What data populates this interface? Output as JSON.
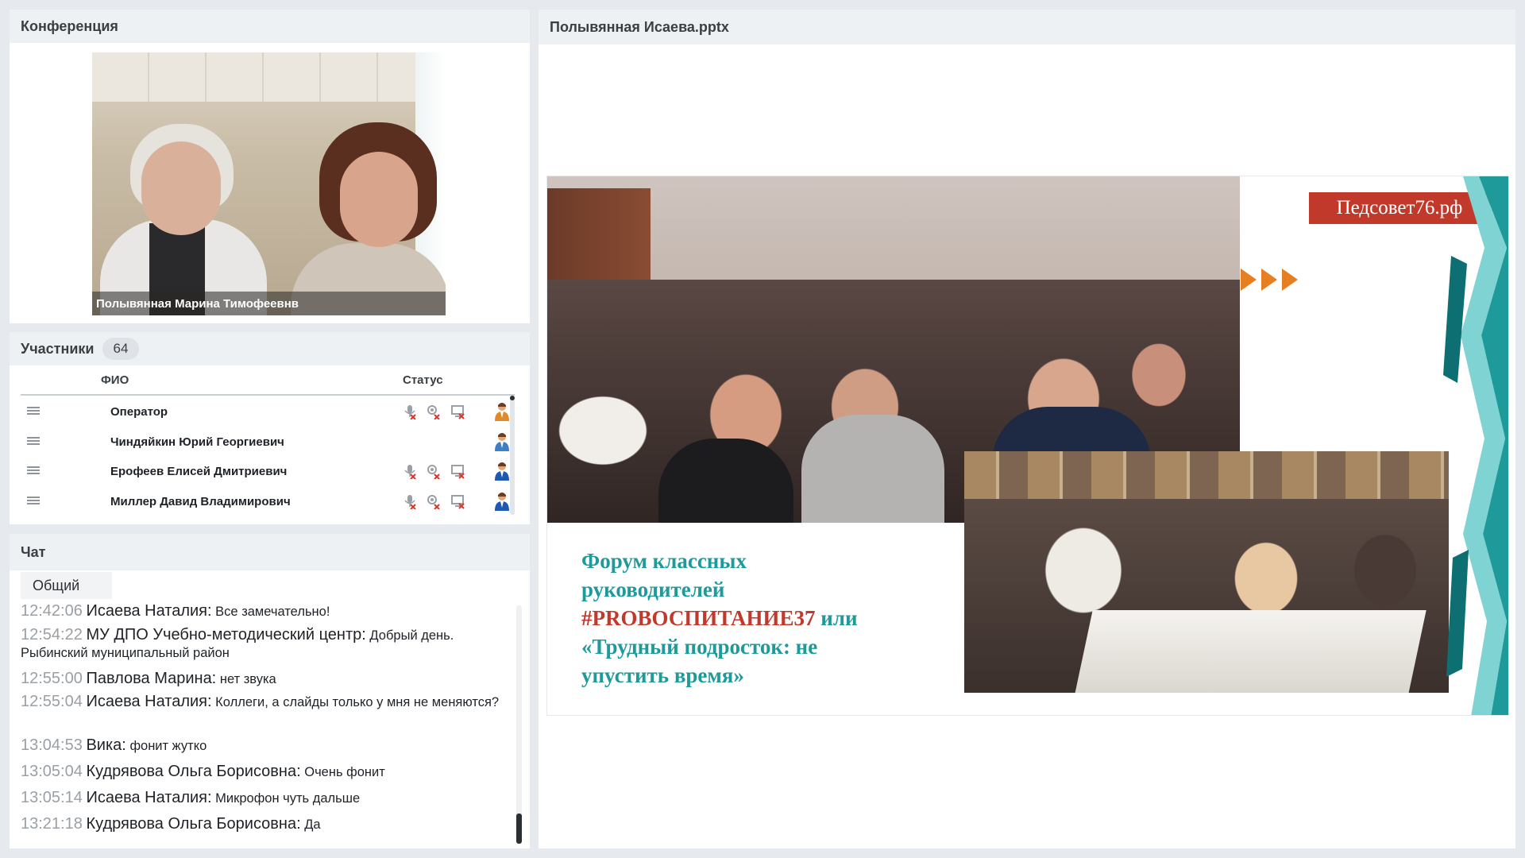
{
  "conference": {
    "title": "Конференция",
    "video_caption": "Полывянная Марина  Тимофеевнв"
  },
  "participants": {
    "title": "Участники",
    "count": "64",
    "col_name": "ФИО",
    "col_status": "Статус",
    "rows": [
      {
        "name": "Оператор"
      },
      {
        "name": "Чиндяйкин Юрий  Георгиевич"
      },
      {
        "name": "Ерофеев Елисей  Дмитриевич"
      },
      {
        "name": "Миллер Давид  Владимирович"
      }
    ]
  },
  "chat": {
    "title": "Чат",
    "tab": "Общий",
    "messages": [
      {
        "time": "12:42:06",
        "author": "Исаева Наталия:",
        "text": "Все замечательно!"
      },
      {
        "time": "12:54:22",
        "author": "МУ ДПО Учебно-методический центр:",
        "text": "Добрый день. Рыбинский муниципальный район"
      },
      {
        "time": "12:55:00",
        "author": "Павлова Марина:",
        "text": "нет звука"
      },
      {
        "time": "12:55:04",
        "author": "Исаева Наталия:",
        "text": "Коллеги, а слайды только у мня не меняются?"
      },
      {
        "time": "13:04:53",
        "author": "Вика:",
        "text": "фонит жутко"
      },
      {
        "time": "13:05:04",
        "author": "Кудрявова Ольга  Борисовна:",
        "text": "Очень фонит"
      },
      {
        "time": "13:05:14",
        "author": "Исаева Наталия:",
        "text": "Микрофон чуть дальше"
      },
      {
        "time": "13:21:18",
        "author": "Кудрявова Ольга  Борисовна:",
        "text": "Да"
      }
    ]
  },
  "presentation": {
    "title": "Полывянная Исаева.pptx",
    "slide": {
      "brand": "Педсовет76.рф",
      "line1": "Форум классных",
      "line2": "руководителей",
      "hashtag": "#PROВОСПИТАНИЕ37",
      "or_word": " или",
      "line4": "«Трудный подросток: не",
      "line5": "упустить  время»"
    }
  },
  "colors": {
    "accent_teal": "#1e9a9a",
    "accent_red": "#c0392b",
    "mute_red": "#d9342b"
  }
}
